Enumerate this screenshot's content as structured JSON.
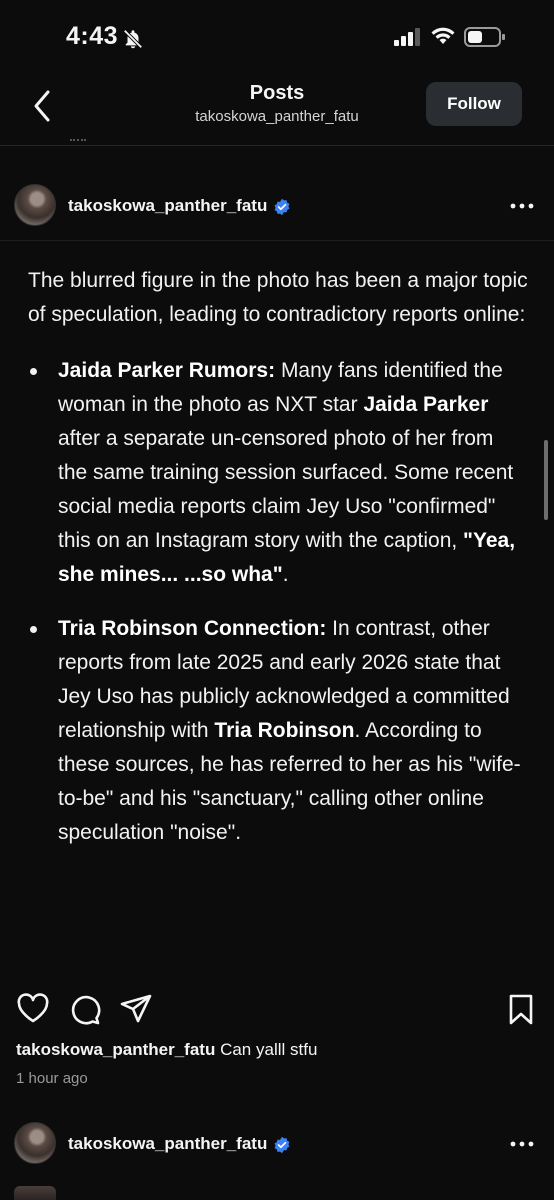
{
  "status_bar": {
    "time": "4:43"
  },
  "nav": {
    "title": "Posts",
    "subtitle": "takoskowa_panther_fatu",
    "follow_label": "Follow"
  },
  "post": {
    "username": "takoskowa_panther_fatu",
    "intro": "The blurred figure in the photo has been a major topic of speculation, leading to contradictory reports online:",
    "bullets": [
      {
        "segments": [
          {
            "text": "Jaida Parker Rumors:",
            "bold": true
          },
          {
            "text": " Many fans identified the woman in the photo as NXT star ",
            "bold": false
          },
          {
            "text": "Jaida Parker",
            "bold": true
          },
          {
            "text": " after a separate un-censored photo of her from the same training session surfaced. Some recent social media reports claim Jey Uso \"confirmed\" this on an Instagram story with the caption, ",
            "bold": false
          },
          {
            "text": "\"Yea, she mines... ...so wha\"",
            "bold": true
          },
          {
            "text": ".",
            "bold": false
          }
        ]
      },
      {
        "segments": [
          {
            "text": "Tria Robinson Connection:",
            "bold": true
          },
          {
            "text": " In contrast, other reports from late 2025 and early 2026 state that Jey Uso has publicly acknowledged a committed relationship with ",
            "bold": false
          },
          {
            "text": "Tria Robinson",
            "bold": true
          },
          {
            "text": ". According to these sources, he has referred to her as his \"wife-to-be\" and his \"sanctuary,\" calling other online speculation \"noise\".",
            "bold": false
          }
        ]
      }
    ],
    "caption_username": "takoskowa_panther_fatu",
    "caption_text": "Can yalll stfu",
    "timestamp": "1 hour ago"
  },
  "next_post": {
    "username": "takoskowa_panther_fatu"
  },
  "colors": {
    "background": "#0c0c0c",
    "verified": "#3b82f6",
    "follow_button": "#2a2e33"
  },
  "icons": [
    "bell-slash-icon",
    "signal-icon",
    "wifi-icon",
    "battery-icon",
    "back-chevron-icon",
    "verified-badge-icon",
    "more-icon",
    "heart-icon",
    "comment-icon",
    "share-icon",
    "bookmark-icon"
  ]
}
